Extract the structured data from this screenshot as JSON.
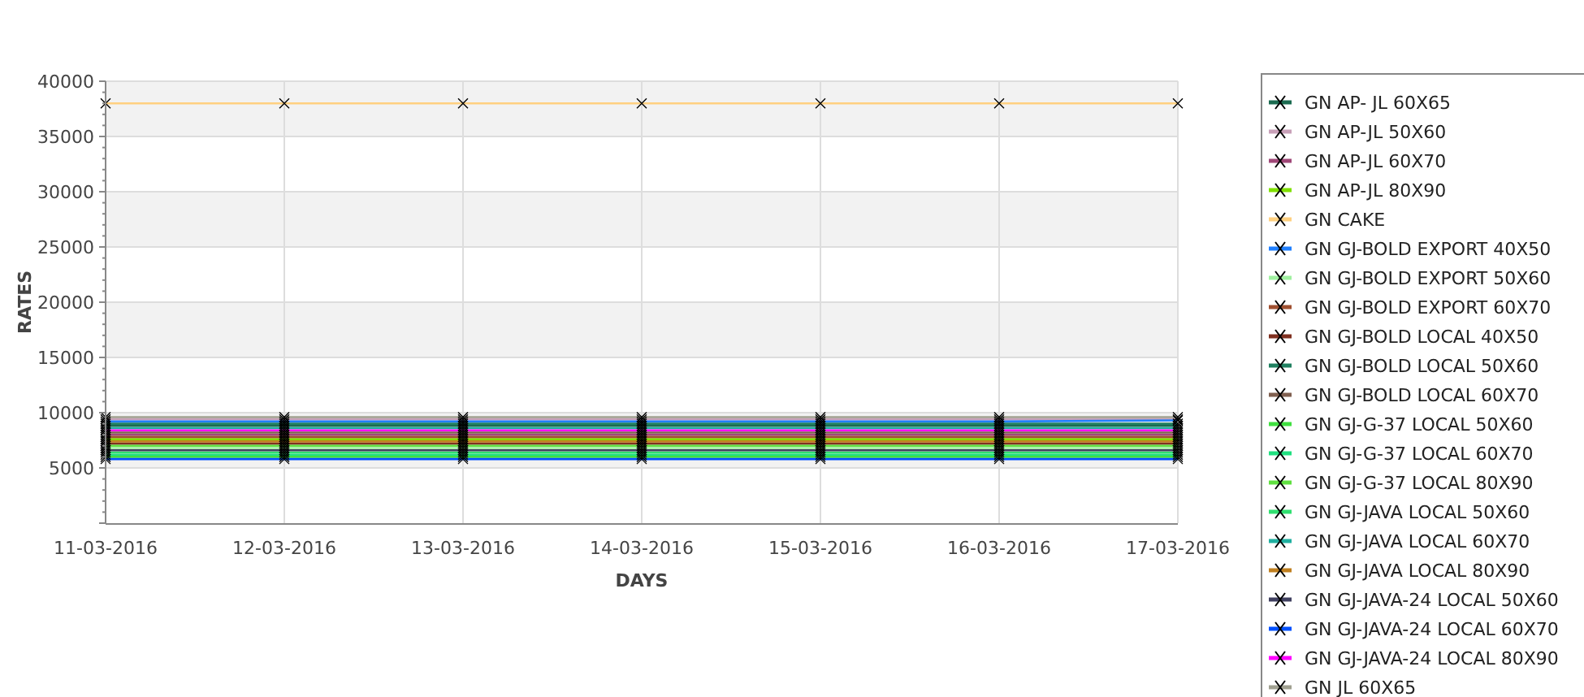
{
  "chart": {
    "chart_data": {
      "type": "line",
      "grid": true,
      "xlabel": "DAYS",
      "ylabel": "RATES",
      "categories": [
        "11-03-2016",
        "12-03-2016",
        "13-03-2016",
        "14-03-2016",
        "15-03-2016",
        "16-03-2016",
        "17-03-2016"
      ],
      "ylim": [
        0,
        40000
      ],
      "yticks": [
        5000,
        10000,
        15000,
        20000,
        25000,
        30000,
        35000,
        40000
      ],
      "series": [
        {
          "name": "GN AP- JL 60X65",
          "color": "#1b6b50",
          "marker": "x",
          "values": [
            8800,
            8800,
            8800,
            8800,
            8800,
            8800,
            8800
          ]
        },
        {
          "name": "GN AP-JL 50X60",
          "color": "#c8a0b8",
          "marker": "x",
          "values": [
            9400,
            9400,
            9400,
            9400,
            9400,
            9400,
            9400
          ]
        },
        {
          "name": "GN AP-JL 60X70",
          "color": "#a04878",
          "marker": "x",
          "values": [
            8000,
            8000,
            8000,
            8000,
            8000,
            8000,
            8000
          ]
        },
        {
          "name": "GN AP-JL 80X90",
          "color": "#80e000",
          "marker": "x",
          "values": [
            7600,
            7600,
            7600,
            7600,
            7600,
            7600,
            7600
          ]
        },
        {
          "name": "GN CAKE",
          "color": "#ffd080",
          "marker": "x",
          "values": [
            38000,
            38000,
            38000,
            38000,
            38000,
            38000,
            38000
          ]
        },
        {
          "name": "GN GJ-BOLD EXPORT 40X50",
          "color": "#2080ff",
          "marker": "x",
          "values": [
            9200,
            9200,
            9200,
            9200,
            9200,
            9200,
            9300
          ]
        },
        {
          "name": "GN GJ-BOLD EXPORT 50X60",
          "color": "#a0f0a0",
          "marker": "x",
          "values": [
            6800,
            6800,
            6800,
            6800,
            6800,
            6800,
            6800
          ]
        },
        {
          "name": "GN GJ-BOLD EXPORT 60X70",
          "color": "#a05030",
          "marker": "x",
          "values": [
            7800,
            7800,
            7800,
            7800,
            7800,
            7800,
            7800
          ]
        },
        {
          "name": "GN GJ-BOLD LOCAL 40X50",
          "color": "#803020",
          "marker": "x",
          "values": [
            7200,
            7200,
            7200,
            7200,
            7200,
            7200,
            7200
          ]
        },
        {
          "name": "GN GJ-BOLD LOCAL 50X60",
          "color": "#208060",
          "marker": "x",
          "values": [
            9000,
            9000,
            9000,
            9000,
            9000,
            9000,
            9000
          ]
        },
        {
          "name": "GN GJ-BOLD LOCAL 60X70",
          "color": "#806050",
          "marker": "x",
          "values": [
            8200,
            8200,
            8200,
            8200,
            8200,
            8200,
            8200
          ]
        },
        {
          "name": "GN GJ-G-37 LOCAL 50X60",
          "color": "#40e040",
          "marker": "x",
          "values": [
            6000,
            6000,
            6000,
            6000,
            6000,
            6000,
            6000
          ]
        },
        {
          "name": "GN GJ-G-37 LOCAL 60X70",
          "color": "#20e080",
          "marker": "x",
          "values": [
            6200,
            6200,
            6200,
            6200,
            6200,
            6200,
            6200
          ]
        },
        {
          "name": "GN GJ-G-37 LOCAL 80X90",
          "color": "#60e040",
          "marker": "x",
          "values": [
            7000,
            7000,
            7000,
            7000,
            7000,
            7000,
            7000
          ]
        },
        {
          "name": "GN GJ-JAVA LOCAL 50X60",
          "color": "#30e070",
          "marker": "x",
          "values": [
            6400,
            6400,
            6400,
            6400,
            6400,
            6400,
            6400
          ]
        },
        {
          "name": "GN GJ-JAVA LOCAL 60X70",
          "color": "#20b0a0",
          "marker": "x",
          "values": [
            8600,
            8600,
            8600,
            8600,
            8600,
            8600,
            8600
          ]
        },
        {
          "name": "GN GJ-JAVA LOCAL 80X90",
          "color": "#c08020",
          "marker": "x",
          "values": [
            7400,
            7400,
            7400,
            7400,
            7400,
            7400,
            7400
          ]
        },
        {
          "name": "GN GJ-JAVA-24 LOCAL 50X60",
          "color": "#404060",
          "marker": "x",
          "values": [
            6600,
            6600,
            6600,
            6600,
            6600,
            6600,
            6600
          ]
        },
        {
          "name": "GN GJ-JAVA-24 LOCAL 60X70",
          "color": "#0050ff",
          "marker": "x",
          "values": [
            5800,
            5800,
            5800,
            5800,
            5800,
            5800,
            5800
          ]
        },
        {
          "name": "GN GJ-JAVA-24 LOCAL 80X90",
          "color": "#ff00ff",
          "marker": "x",
          "values": [
            8400,
            8400,
            8400,
            8400,
            8400,
            8400,
            8400
          ]
        },
        {
          "name": "GN JL 60X65",
          "color": "#a0a090",
          "marker": "x",
          "values": [
            9600,
            9600,
            9600,
            9600,
            9600,
            9600,
            9600
          ]
        }
      ]
    }
  }
}
